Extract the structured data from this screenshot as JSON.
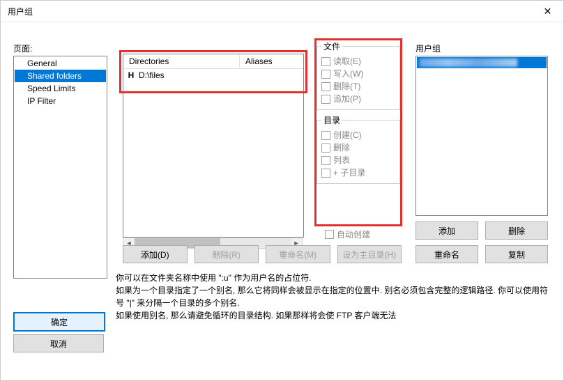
{
  "window": {
    "title": "用户组"
  },
  "pages": {
    "label": "页面:",
    "items": [
      {
        "label": "General"
      },
      {
        "label": "Shared folders",
        "selected": true
      },
      {
        "label": "Speed Limits"
      },
      {
        "label": "IP Filter"
      }
    ]
  },
  "directories": {
    "columns": {
      "dir": "Directories",
      "alias": "Aliases"
    },
    "rows": [
      {
        "home_marker": "H",
        "path": "D:\\files",
        "alias": ""
      }
    ],
    "buttons": {
      "add": "添加(D)",
      "remove": "删除(R)",
      "rename": "重命名(M)",
      "set_home": "设为主目录(H)"
    }
  },
  "permissions": {
    "file": {
      "legend": "文件",
      "read": "读取(E)",
      "write": "写入(W)",
      "delete": "删除(T)",
      "append": "追加(P)"
    },
    "dir": {
      "legend": "目录",
      "create": "创建(C)",
      "delete": "删除",
      "list": "列表",
      "subdirs": "+ 子目录"
    },
    "auto_create": "自动创建"
  },
  "user_groups": {
    "label": "用户组",
    "buttons": {
      "add": "添加",
      "remove": "删除",
      "rename": "重命名",
      "copy": "复制"
    }
  },
  "help": {
    "line1": "你可以在文件夹名称中使用 \":u\" 作为用户名的占位符.",
    "line2": "如果为一个目录指定了一个别名, 那么它将同样会被显示在指定的位置中. 别名必须包含完整的逻辑路径. 你可以使用符号 \"|\" 来分隔一个目录的多个别名.",
    "line3": "如果使用别名, 那么请避免循环的目录结构. 如果那样将会使 FTP 客户端无法"
  },
  "dialog": {
    "ok": "确定",
    "cancel": "取消"
  }
}
